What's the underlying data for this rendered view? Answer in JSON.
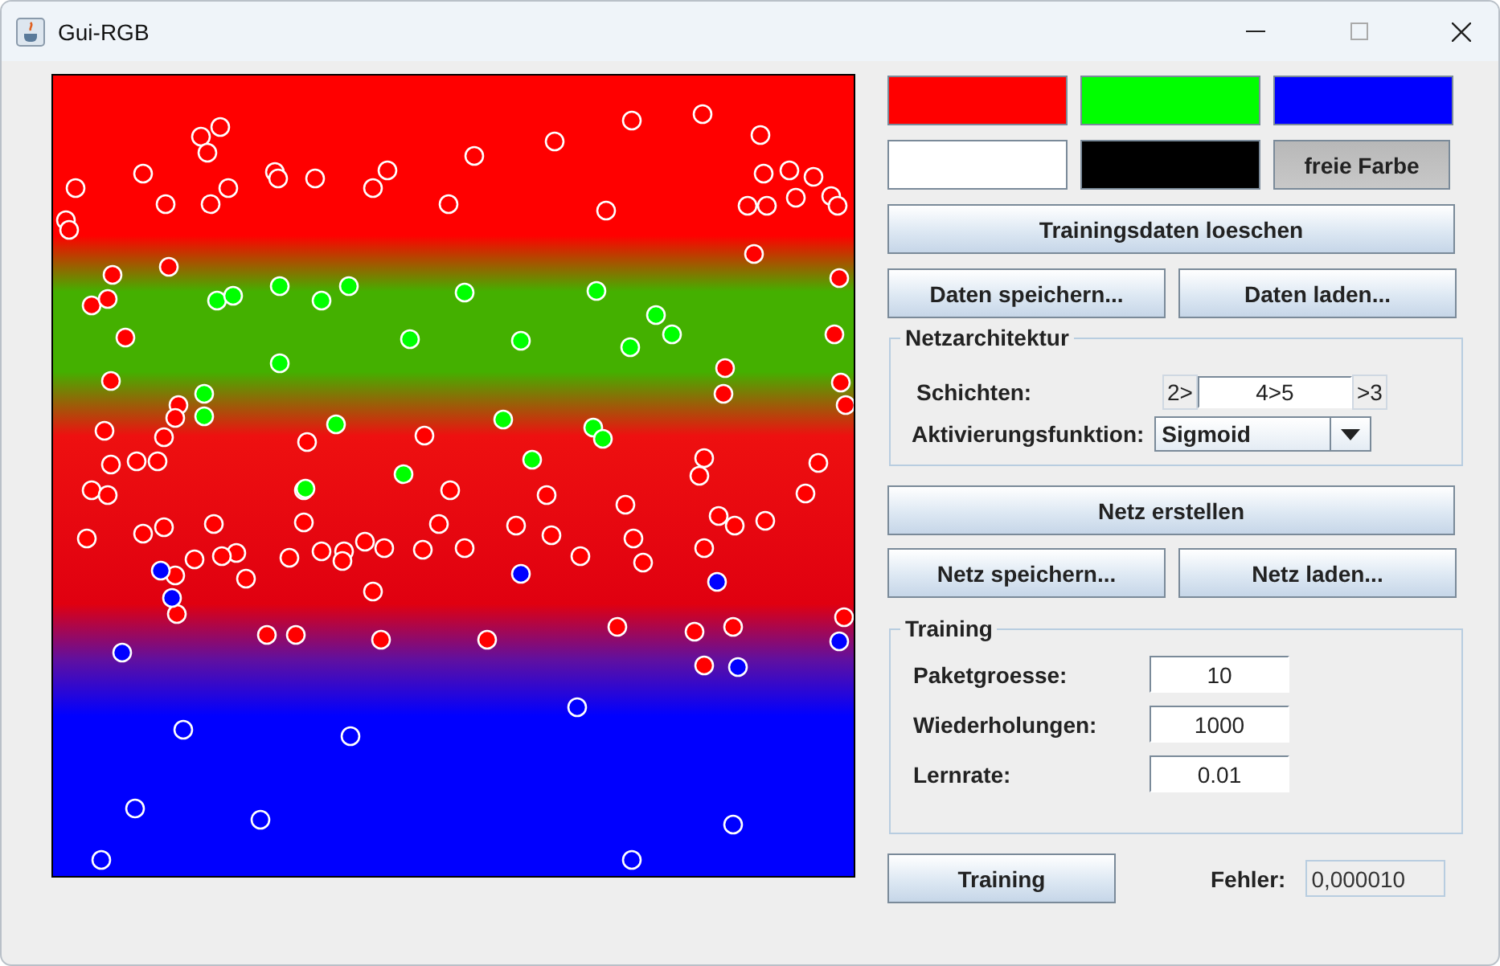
{
  "window": {
    "title": "Gui-RGB"
  },
  "color_swatches": [
    {
      "color": "#ff0000"
    },
    {
      "color": "#00ff00"
    },
    {
      "color": "#0000ff"
    },
    {
      "color": "#ffffff"
    },
    {
      "color": "#000000"
    }
  ],
  "free_color_button": {
    "label": "freie Farbe",
    "selected": true
  },
  "clear_button": "Trainingsdaten loeschen",
  "data_buttons": [
    "Daten speichern...",
    "Daten laden..."
  ],
  "network_architecture": {
    "title": "Netzarchitektur",
    "layers_label": "Schichten:",
    "layers_prefix": "2>",
    "layers_value": "4>5",
    "layers_suffix": ">3",
    "activation_label": "Aktivierungsfunktion:",
    "activation_value": "Sigmoid"
  },
  "create_button": "Netz erstellen",
  "net_buttons": [
    "Netz speichern...",
    "Netz laden..."
  ],
  "training": {
    "title": "Training",
    "fields": [
      {
        "label": "Paketgroesse:",
        "value": "10"
      },
      {
        "label": "Wiederholungen:",
        "value": "1000"
      },
      {
        "label": "Lernrate:",
        "value": "0.01"
      }
    ]
  },
  "train_button": "Training",
  "error": {
    "label": "Fehler:",
    "value": "0,000010"
  }
}
